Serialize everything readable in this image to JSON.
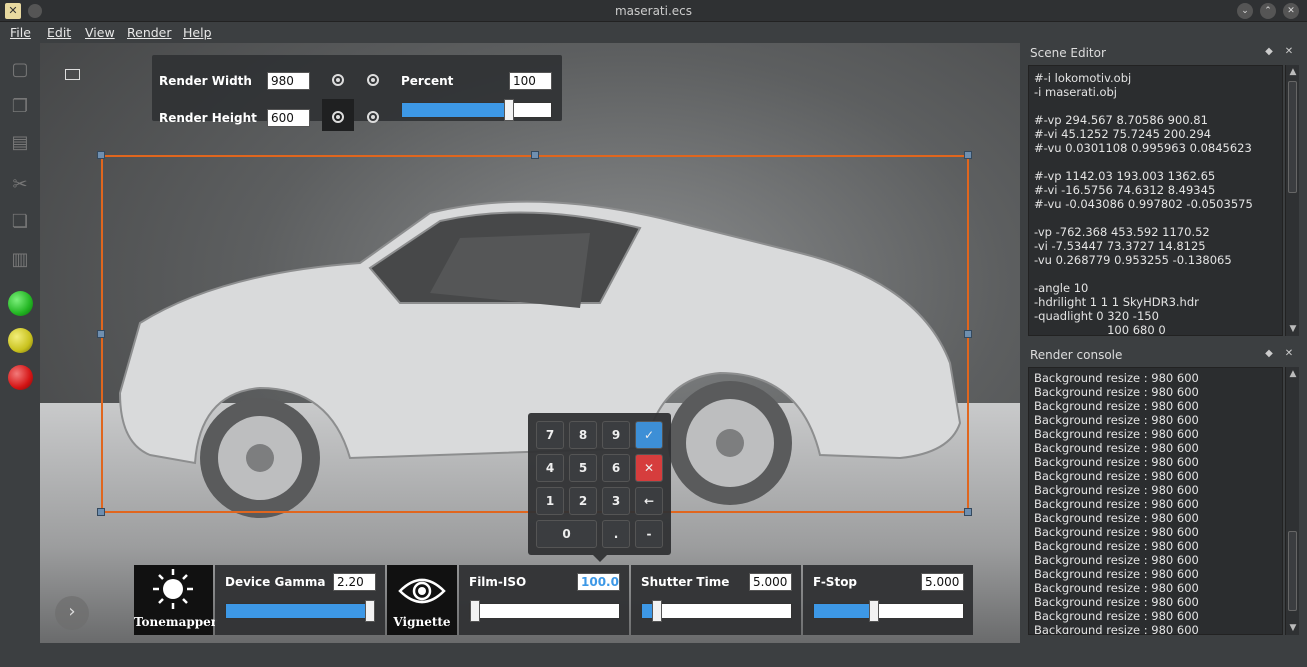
{
  "window": {
    "title": "maserati.ecs"
  },
  "menu": [
    "File",
    "Edit",
    "View",
    "Render",
    "Help"
  ],
  "render_settings": {
    "width_label": "Render Width",
    "width_value": "980",
    "height_label": "Render Height",
    "height_value": "600",
    "percent_label": "Percent",
    "percent_value": "100",
    "percent_slider_level": 0.72
  },
  "numpad": {
    "keys": [
      "7",
      "8",
      "9",
      "4",
      "5",
      "6",
      "1",
      "2",
      "3",
      "0",
      ".",
      "-"
    ],
    "confirm_color": "#3d8fd6",
    "cancel_color": "#d63d3d"
  },
  "bottom_bar": {
    "tonemapper_label": "Tonemapper",
    "device_gamma_label": "Device Gamma",
    "device_gamma_value": "2.20",
    "device_gamma_level": 0.98,
    "vignette_label": "Vignette",
    "film_iso_label": "Film-ISO",
    "film_iso_value": "100.0",
    "film_iso_level": 0.02,
    "shutter_label": "Shutter Time",
    "shutter_value": "5.000",
    "shutter_level": 0.1,
    "fstop_label": "F-Stop",
    "fstop_value": "5.000",
    "fstop_level": 0.4
  },
  "scene_editor": {
    "title": "Scene Editor",
    "lines": [
      "#-i lokomotiv.obj",
      "-i maserati.obj",
      "",
      "#-vp 294.567 8.70586 900.81",
      "#-vi 45.1252 75.7245 200.294",
      "#-vu 0.0301108 0.995963 0.0845623",
      "",
      "#-vp 1142.03 193.003 1362.65",
      "#-vi -16.5756 74.6312 8.49345",
      "#-vu -0.043086 0.997802 -0.0503575",
      "",
      "-vp -762.368 453.592 1170.52",
      "-vi -7.53447 73.3727 14.8125",
      "-vu 0.268779 0.953255 -0.138065",
      "",
      "-angle 10",
      "-hdrilight 1 1 1 SkyHDR3.hdr",
      "-quadlight 0 320 -150",
      "                    100 680 0"
    ]
  },
  "render_console": {
    "title": "Render console",
    "lines": [
      "Background resize : 980 600",
      "Background resize : 980 600",
      "Background resize : 980 600",
      "Background resize : 980 600",
      "Background resize : 980 600",
      "Background resize : 980 600",
      "Background resize : 980 600",
      "Background resize : 980 600",
      "Background resize : 980 600",
      "Background resize : 980 600",
      "Background resize : 980 600",
      "Background resize : 980 600",
      "Background resize : 980 600",
      "Background resize : 980 600",
      "Background resize : 980 600",
      "Background resize : 980 600",
      "Background resize : 980 600",
      "Background resize : 980 600",
      "Background resize : 980 600"
    ]
  },
  "colors": {
    "selection": "#e0661e",
    "slider": "#3d98e6",
    "green": "#22b522",
    "yellow": "#c9c21e",
    "red": "#d41414"
  }
}
